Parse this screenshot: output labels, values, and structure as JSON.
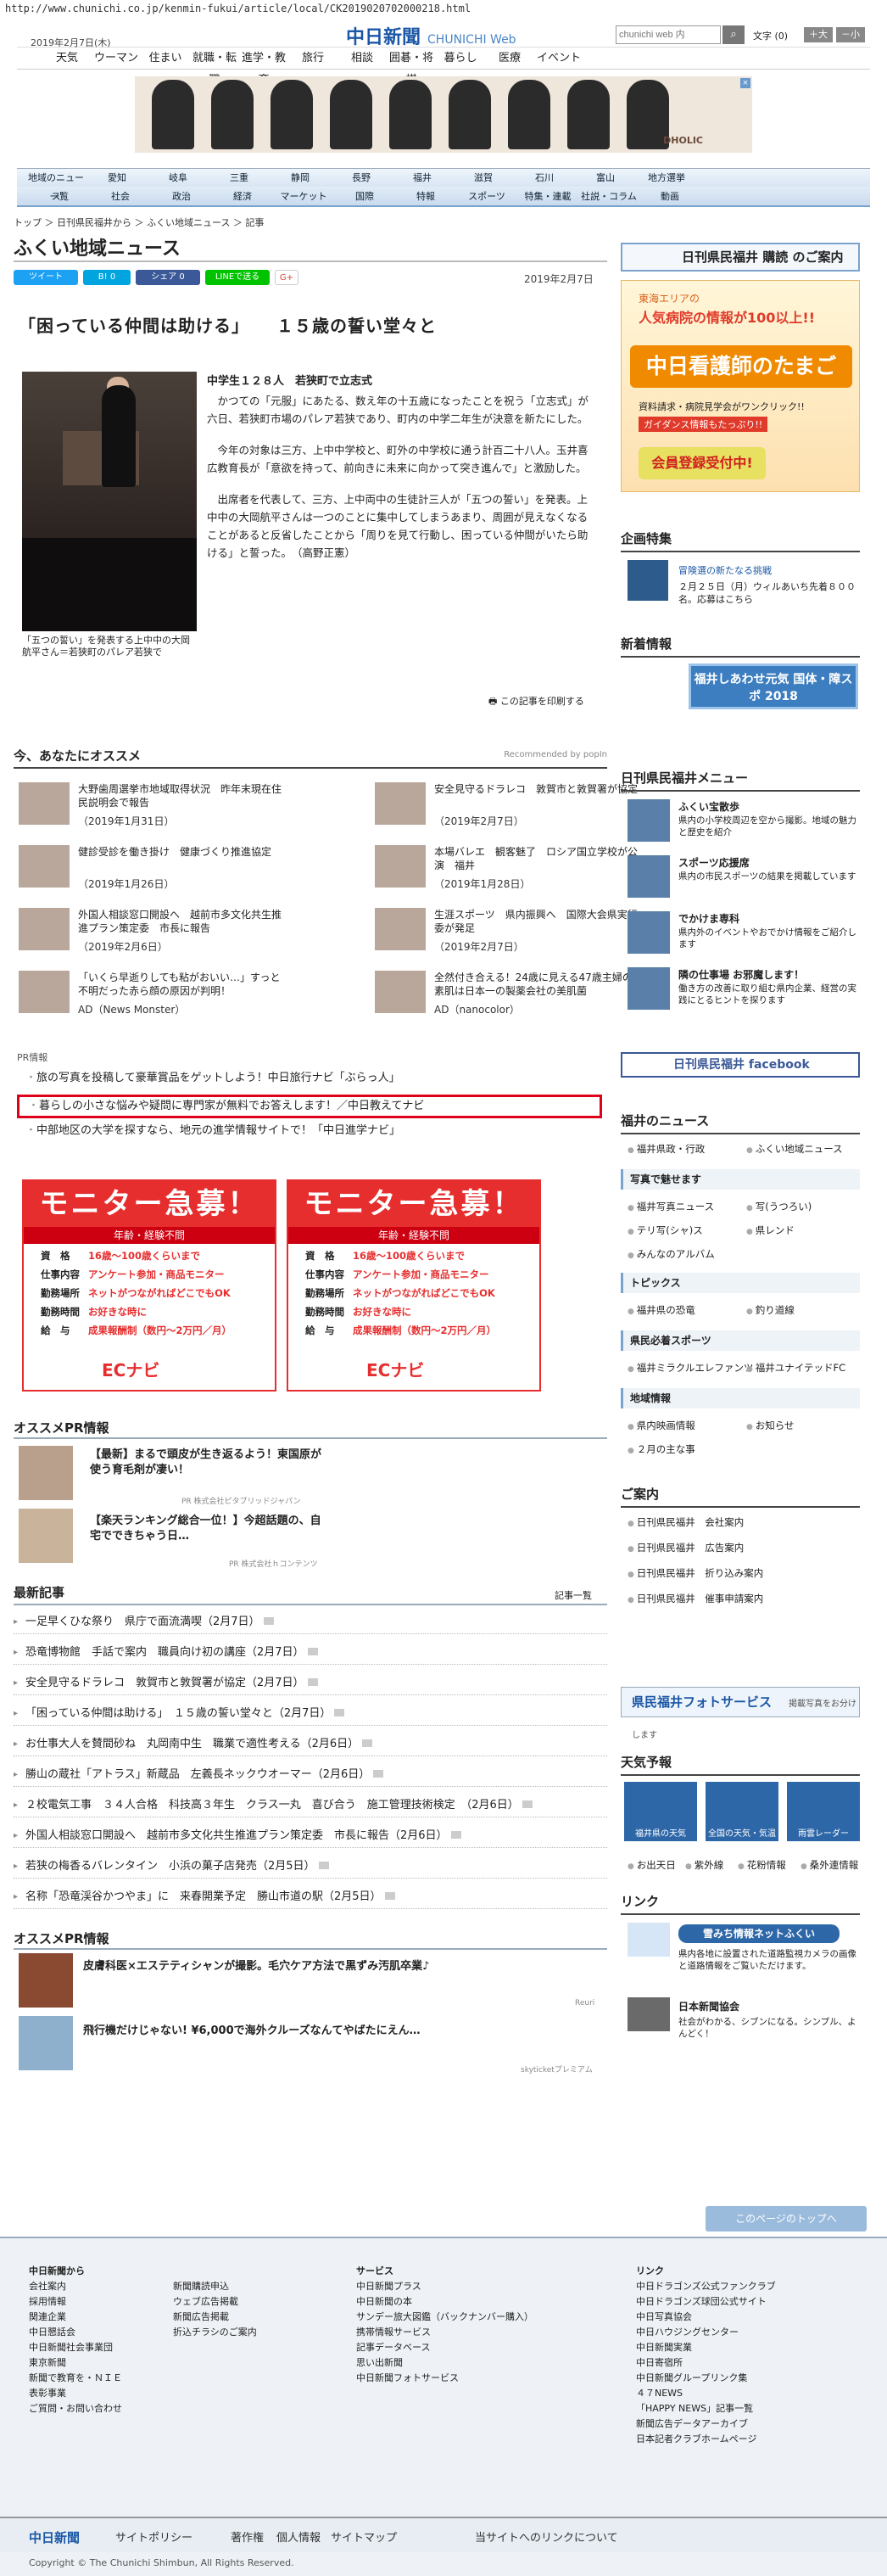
{
  "url": "http://www.chunichi.co.jp/kenmin-fukui/article/local/CK2019020702000218.html",
  "header": {
    "date": "2019年2月7日(木)",
    "logo": "中日新聞",
    "logo_sub": "CHUNICHI Web",
    "search_placeholder": "chunichi web 内",
    "font_label": "文字 (0)",
    "font_plus": "＋大",
    "font_minus": "－小"
  },
  "gnav": [
    "天気",
    "ウーマン",
    "住まい",
    "就職・転職",
    "進学・教育",
    "旅行",
    "相談",
    "囲碁・将棋",
    "暮らし",
    "医療",
    "イベント"
  ],
  "ad_banner": {
    "brand": "DHOLIC"
  },
  "local_nav": {
    "row1": [
      "地域のニュース",
      "愛知",
      "岐阜",
      "三重",
      "静岡",
      "長野",
      "福井",
      "滋賀",
      "石川",
      "富山",
      "地方選挙"
    ],
    "row2": [
      "一覧",
      "社会",
      "政治",
      "経済",
      "マーケット",
      "国際",
      "特報",
      "スポーツ",
      "特集・連載",
      "社説・コラム",
      "動画"
    ]
  },
  "breadcrumb": "トップ ＞ 日刊県民福井から ＞ ふくい地域ニュース ＞ 記事",
  "section_title": "ふくい地域ニュース",
  "share": {
    "tweet": "ツイート",
    "hatena": "B! 0",
    "facebook": "シェア 0",
    "line": "LINEで送る",
    "gplus": "G+"
  },
  "article": {
    "date": "2019年2月7日",
    "headline": "「困っている仲間は助ける」　　１５歳の誓い堂々と",
    "photo_caption": "「五つの誓い」を発表する上中中の大岡航平さん＝若狭町のパレア若狭で",
    "lead": "中学生１２８人　若狭町で立志式",
    "paragraphs": [
      "かつての「元服」にあたる、数え年の十五歳になったことを祝う「立志式」が六日、若狭町市場のパレア若狭であり、町内の中学二年生が決意を新たにした。",
      "今年の対象は三方、上中中学校と、町外の中学校に通う計百二十八人。玉井喜広教育長が「意欲を持って、前向きに未来に向かって突き進んで」と激励した。",
      "出席者を代表して、三方、上中両中の生徒計三人が「五つの誓い」を発表。上中中の大岡航平さんは一つのことに集中してしまうあまり、周囲が見えなくなることがあると反省したことから「周りを見て行動し、困っている仲間がいたら助ける」と誓った。　（高野正憲）"
    ],
    "print": "この記事を印刷する"
  },
  "recommend": {
    "title": "今、あなたにオススメ",
    "by": "Recommended by  popIn",
    "items": [
      {
        "text": "大野歯周選挙市地域取得状況　昨年末現在住民説明会で報告",
        "date": "（2019年1月31日）"
      },
      {
        "text": "安全見守るドラレコ　敦賀市と敦賀署が協定",
        "date": "（2019年2月7日）"
      },
      {
        "text": "健診受診を働き掛け　健康づくり推進協定",
        "date": "（2019年1月26日）"
      },
      {
        "text": "本場バレエ　観客魅了　ロシア国立学校が公演　福井",
        "date": "（2019年1月28日）"
      },
      {
        "text": "外国人相談窓口開設へ　越前市多文化共生推進プラン策定委　市長に報告",
        "date": "（2019年2月6日）"
      },
      {
        "text": "生涯スポーツ　県内振興へ　国際大会県実行委が発足",
        "date": "（2019年2月7日）"
      },
      {
        "text": "「いくら早逝りしても粘がおいい…」すっと不明だった赤ら顔の原因が判明！",
        "date": "AD（News Monster）"
      },
      {
        "text": "全然付き合える！24歳に見える47歳主婦の素肌は日本一の製薬会社の美肌菌",
        "date": "AD（nanocolor）"
      }
    ]
  },
  "pr": {
    "label": "PR情報",
    "links": [
      "旅の写真を投稿して豪華賞品をゲットしよう！中日旅行ナビ「ぶらっ人」",
      "暮らしの小さな悩みや疑問に専門家が無料でお答えします！／中日教えてナビ",
      "中部地区の大学を探すなら、地元の進学情報サイトで！「中日進学ナビ」"
    ]
  },
  "monitor": {
    "title": "モニター急募！",
    "sub": "年齢・経験不問",
    "rows": [
      {
        "k": "資　格",
        "v": "16歳～100歳くらいまで"
      },
      {
        "k": "仕事内容",
        "v": "アンケート参加・商品モニター"
      },
      {
        "k": "勤務場所",
        "v": "ネットがつながればどこでもOK"
      },
      {
        "k": "勤務時間",
        "v": "お好きな時に"
      },
      {
        "k": "給　与",
        "v": "成果報酬制（数円～2万円／月）"
      }
    ],
    "brand": "ECナビ"
  },
  "oss_pr": {
    "title": "オススメPR情報",
    "items": [
      {
        "text": "【最新】まるで頭皮が生き返るよう！東国原が使う育毛剤が凄い！",
        "by": "PR 株式会社ピタブリッドジャパン"
      },
      {
        "text": "【楽天ランキング総合一位！】今超話題の、自宅でできちゃう日…",
        "by": "PR 株式会社ｈコンテンツ"
      }
    ]
  },
  "latest": {
    "title": "最新記事",
    "more": "記事一覧",
    "items": [
      "一足早くひな祭り　県庁で面流満喫（2月7日）",
      "恐竜博物館　手話で案内　職員向け初の講座（2月7日）",
      "安全見守るドラレコ　敦賀市と敦賀署が協定（2月7日）",
      "「困っている仲間は助ける」　１５歳の誓い堂々と（2月7日）",
      "お仕事大人を賛間砂ね　丸岡南中生　職業で適性考える（2月6日）",
      "勝山の蔵社「アトラス」新蔵品　左義長ネックウオーマー（2月6日）",
      "２校電気工事　３４人合格　科技高３年生　クラス一丸　喜び合う　施工管理技術検定　（2月6日）",
      "外国人相談窓口開設へ　越前市多文化共生推進プラン策定委　市長に報告（2月6日）",
      "若狭の梅香るバレンタイン　小浜の菓子店発売（2月5日）",
      "名称「恐竜渓谷かつやま」に　来春開業予定　勝山市道の駅（2月5日）"
    ]
  },
  "oss_pr2": {
    "title": "オススメPR情報",
    "items": [
      {
        "text": "皮膚科医×エステティシャンが撮影。毛穴ケア方法で黒ずみ汚肌卒業♪",
        "by": "Reuri"
      },
      {
        "text": "飛行機だけじゃない! ¥6,000で海外クルーズなんてやばたにえん…",
        "by": "skyticketプレミアム"
      }
    ]
  },
  "sidebar": {
    "subscribe": "日刊県民福井 購読 のご案内",
    "nurse_ad": {
      "l1": "東海エリアの",
      "l2": "人気病院の情報が100以上!!",
      "l3": "中日看護師のたまご",
      "l4": "資料請求・病院見学会がワンクリック!!",
      "l5": "ガイダンス情報もたっぷり!!",
      "l6": "会員登録受付中!"
    },
    "special_title": "企画特集",
    "special_item": "冒険選の新たなる挑戦",
    "special_text": "２月２５日（月）ウィルあいち先着８００名。応募はこちら",
    "new_title": "新着情報",
    "new_banner": "福井しあわせ元気 国体・障スポ 2018",
    "menu_title": "日刊県民福井メニュー",
    "menu": [
      {
        "t": "ふくい宝散歩",
        "d": "県内の小学校周辺を空から撮影。地域の魅力と歴史を紹介"
      },
      {
        "t": "スポーツ応援席",
        "d": "県内の市民スポーツの結果を掲載しています"
      },
      {
        "t": "でかけま専科",
        "d": "県内外のイベントやおでかけ情報をご紹介します"
      },
      {
        "t": "隣の仕事場 お邪魔します！",
        "d": "働き方の改善に取り組む県内企業、経営の実践にとるヒントを探ります"
      }
    ],
    "facebook": "日刊県民福井 facebook",
    "fukui_title": "福井のニュース",
    "fukui": [
      "福井県政・行政",
      "ふくい地域ニュース"
    ],
    "photo_title": "写真で魅せます",
    "photo": [
      "福井写真ニュース",
      "写(うつろい)",
      "テリ写(シャ)ス",
      "県レンド",
      "みんなのアルバム"
    ],
    "topics_title": "トピックス",
    "topics": [
      "福井県の恐竜",
      "釣り道線"
    ],
    "sports_title": "県民必着スポーツ",
    "sports": [
      "福井ミラクルエレファンツ",
      "福井ユナイテッドFC"
    ],
    "region_title": "地域情報",
    "region": [
      "県内映画情報",
      "お知らせ",
      "２月の主な事"
    ],
    "guide_title": "ご案内",
    "guide": [
      "日刊県民福井　会社案内",
      "日刊県民福井　広告案内",
      "日刊県民福井　折り込み案内",
      "日刊県民福井　催事申請案内"
    ],
    "photoservice": "県民福井フォトサービス",
    "photoservice_sub": "掲載写真をお分けします",
    "weather_title": "天気予報",
    "weather": [
      "福井県の天気",
      "全国の天気・気温",
      "雨雲レーダー"
    ],
    "weather_links": [
      "お出天日",
      "紫外線",
      "花粉情報",
      "桑外連情報"
    ],
    "link_title": "リンク",
    "links": [
      {
        "t": "雪みち情報ネットふくい",
        "d": "県内各地に設置された道路監視カメラの画像と道路情報をご覧いただけます。"
      },
      {
        "t": "日本新聞協会",
        "d": "社会がわかる、シブンになる。シンプル、よんどく！"
      }
    ]
  },
  "totop": "このページのトップへ",
  "footer": {
    "col1_title": "中日新聞から",
    "col1": [
      "会社案内",
      "採用情報",
      "関連企業",
      "中日懇話会",
      "中日新聞社会事業団",
      "東京新聞",
      "新聞で教育を・ＮＩＥ",
      "表彰事業",
      "ご質問・お問い合わせ"
    ],
    "col2": [
      "新聞購読申込",
      "ウェブ広告掲載",
      "新聞広告掲載",
      "折込チラシのご案内"
    ],
    "col3_title": "サービス",
    "col3": [
      "中日新聞プラス",
      "中日新聞の本",
      "サンデー旅大図鑑（バックナンバー購入）",
      "携帯情報サービス",
      "記事データベース",
      "思い出新聞",
      "中日新聞フォトサービス"
    ],
    "col4_title": "リンク",
    "col4": [
      "中日ドラゴンズ公式ファンクラブ",
      "中日ドラゴンズ球団公式サイト",
      "中日写真協会",
      "中日ハウジングセンター",
      "中日新聞実業",
      "中日寄宿所",
      "中日新聞グループリンク集",
      "４７NEWS",
      "「HAPPY NEWS」記事一覧",
      "新聞広告データアーカイブ",
      "日本記者クラブホームページ"
    ],
    "bar": [
      "中日新聞",
      "サイトポリシー",
      "著作権",
      "個人情報",
      "サイトマップ",
      "当サイトへのリンクについて"
    ],
    "copyright": "Copyright © The Chunichi Shimbun, All Rights Reserved."
  },
  "colors": {
    "brand": "#1b57a6",
    "accent_red": "#e62e2e",
    "highlight_box": "#e0001a"
  }
}
